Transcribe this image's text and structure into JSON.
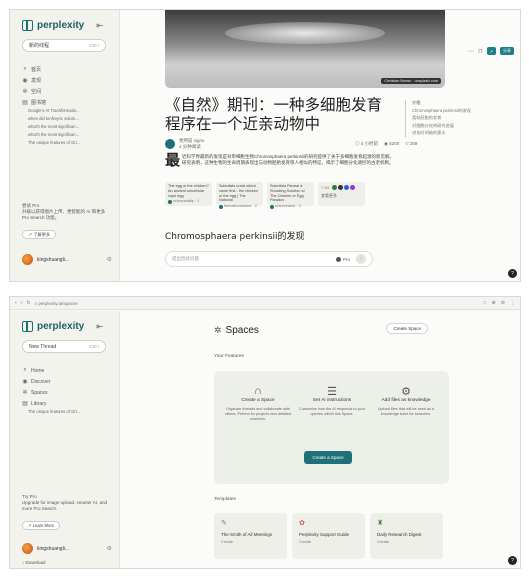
{
  "brand": {
    "name": "perplexity",
    "accent": "#1f7078"
  },
  "frame1": {
    "sidebar": {
      "collapse": "⇤",
      "new_thread": "新的线程",
      "new_thread_kbd": "Ctrl I",
      "nav": [
        {
          "icon": "search-icon",
          "glyph": "⌕",
          "label": "首页"
        },
        {
          "icon": "discover-icon",
          "glyph": "◉",
          "label": "发现"
        },
        {
          "icon": "spaces-icon",
          "glyph": "✲",
          "label": "空间"
        },
        {
          "icon": "library-icon",
          "glyph": "▤",
          "label": "图书馆"
        }
      ],
      "library_items": [
        "Google's AI Transformatio...",
        "when did tenhoyric volum...",
        "what's the most significan...",
        "what's the most significan...",
        "The unique features of Ori..."
      ],
      "try_pro": "尝试 Pro\n升级以获得图片上传、更智能的 AI 和更多 Pro Search 功能。",
      "learn_more": "↗ 了解更多",
      "user_name": "kingshuangli...",
      "gear": "⚙"
    },
    "article": {
      "hero_credit": "Christian Brown · unsplash.com",
      "topbar_btn1": "↗",
      "topbar_btn2": "分享",
      "title": "《自然》期刊：一种多细胞发育程序在一个近亲动物中",
      "author": "更所前 signs",
      "author_sub": "4 分钟阅读",
      "stats": [
        "◎ 4 小时前",
        "◉ 5200",
        "▽ 259"
      ],
      "dropcap": "最",
      "paragraph": "近科学界最新的发现是对单细胞生物Chromosphaera perkinsii的研究提供了关于多细胞发育起源的新见解。研究表明，这种生物的生命周期表现出与动物胚胎发育惊人相似的特征，揭示了细胞分化调控的古老机制。",
      "sources": [
        {
          "title": "The egg or the chicken? An ancient unicellular cope egg",
          "foot": "sciencedaily · 1"
        },
        {
          "title": "Scientists crack which came first - the chicken or the egg | The National",
          "foot": "thenationalnews · 2"
        },
        {
          "title": "Scientists Reveal a Shocking Solution to The Chicken or Egg Paradox",
          "foot": "sciencealert · 3"
        }
      ],
      "more_sources": "查看更多",
      "more_sources_count": "+ 24",
      "section_heading": "Chromosphaera perkinsii的发现",
      "ask_placeholder": "提出后续问题",
      "ask_pro": "Pro",
      "ask_send": "↑",
      "toc": [
        "介绍",
        "Chromosphaera perkinsii的发现",
        "类似胚胎的发育",
        "对细胞分化的研究进展",
        "进化时间轴的意义"
      ],
      "help": "?"
    }
  },
  "frame2": {
    "browser": {
      "back": "‹",
      "forward": "›",
      "reload": "↻",
      "url": "≡  perplexity.ai/spaces",
      "icons": [
        "☆",
        "⊕",
        "⊘",
        "⋮"
      ]
    },
    "sidebar": {
      "new_thread": "New Thread",
      "new_thread_kbd": "Ctrl I",
      "nav": [
        {
          "icon": "home-icon",
          "glyph": "⌕",
          "label": "Home"
        },
        {
          "icon": "discover-icon",
          "glyph": "◉",
          "label": "Discover"
        },
        {
          "icon": "spaces-icon",
          "glyph": "✲",
          "label": "Spaces"
        },
        {
          "icon": "library-icon",
          "glyph": "▤",
          "label": "Library"
        }
      ],
      "library_items": [
        "The unique features of Ori..."
      ],
      "try_pro": "Try Pro\nUpgrade for image upload, smarter AI, and more Pro Search.",
      "learn_more": "↗ Learn More",
      "user_name": "kingshuangli...",
      "gear": "⚙",
      "download": "↓ Download"
    },
    "spaces": {
      "title": "Spaces",
      "create_label": "Create Space",
      "featured_label": "Your Features",
      "features": [
        {
          "glyph": "∩",
          "title": "Create a Space",
          "desc": "Organize threads and collaborate with others. Perfect for projects and detailed research."
        },
        {
          "glyph": "☰",
          "title": "Set AI instructions",
          "desc": "Customize how the AI responds to your queries within this Space."
        },
        {
          "glyph": "⚙",
          "title": "Add files as knowledge",
          "desc": "Upload files that will be used as a knowledge base for searches."
        }
      ],
      "feature_button": "Create a Space",
      "templates_label": "Templates",
      "templates": [
        {
          "glyph": "✎",
          "name": "The Smith of All Meetings",
          "sub": "Create",
          "color": "#7a6bd8"
        },
        {
          "glyph": "✿",
          "name": "Perplexity Support Guide",
          "sub": "Create",
          "color": "#d06060"
        },
        {
          "glyph": "♜",
          "name": "Daily Research Digest",
          "sub": "Create",
          "color": "#4a8a55"
        }
      ],
      "help": "?"
    }
  }
}
